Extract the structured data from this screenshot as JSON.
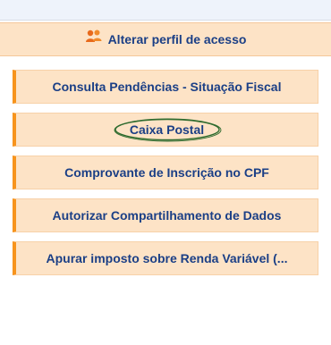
{
  "profile": {
    "label": "Alterar perfil de acesso",
    "icon": "users-icon"
  },
  "menu": {
    "items": [
      {
        "label": "Consulta Pendências - Situação Fiscal"
      },
      {
        "label": "Caixa Postal"
      },
      {
        "label": "Comprovante de Inscrição no CPF"
      },
      {
        "label": "Autorizar Compartilhamento de Dados"
      },
      {
        "label": "Apurar imposto sobre Renda Variável (..."
      }
    ]
  },
  "colors": {
    "item_background": "#fde3c6",
    "accent": "#f7941d",
    "text": "#1b3f86",
    "circle_highlight": "#2e6b2e"
  }
}
